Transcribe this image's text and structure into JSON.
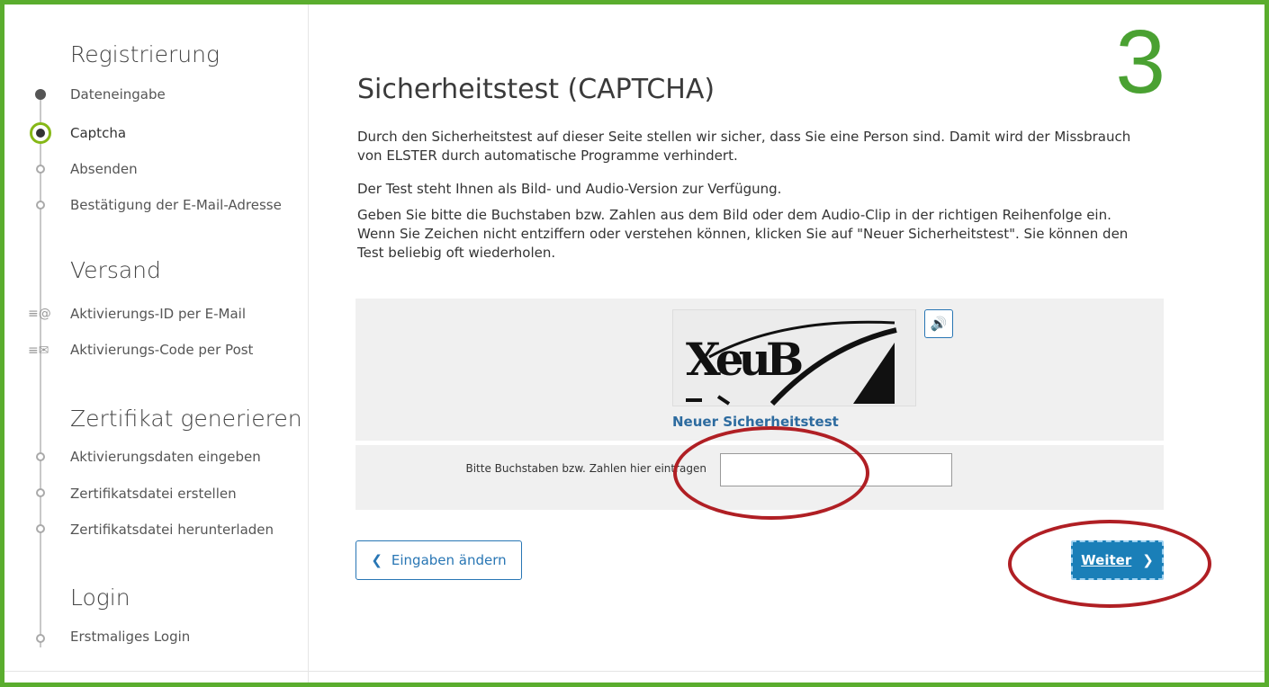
{
  "step_number": "3",
  "sidebar": {
    "sections": [
      {
        "title": "Registrierung",
        "items": [
          {
            "label": "Dateneingabe",
            "state": "done"
          },
          {
            "label": "Captcha",
            "state": "current"
          },
          {
            "label": "Absenden",
            "state": "pending"
          },
          {
            "label": "Bestätigung der E-Mail-Adresse",
            "state": "pending"
          }
        ]
      },
      {
        "title": "Versand",
        "items": [
          {
            "label": "Aktivierungs-ID per E-Mail",
            "icon": "email-at-icon"
          },
          {
            "label": "Aktivierungs-Code per Post",
            "icon": "letter-icon"
          }
        ]
      },
      {
        "title": "Zertifikat generieren",
        "items": [
          {
            "label": "Aktivierungsdaten eingeben",
            "state": "pending"
          },
          {
            "label": "Zertifikatsdatei erstellen",
            "state": "pending"
          },
          {
            "label": "Zertifikatsdatei herunterladen",
            "state": "pending"
          }
        ]
      },
      {
        "title": "Login",
        "items": [
          {
            "label": "Erstmaliges Login",
            "state": "pending"
          }
        ]
      }
    ]
  },
  "main": {
    "title": "Sicherheitstest (CAPTCHA)",
    "paragraphs": [
      "Durch den Sicherheitstest auf dieser Seite stellen wir sicher, dass Sie eine Person sind. Damit wird der Missbrauch von ELSTER durch automatische Programme verhindert.",
      "Der Test steht Ihnen als Bild- und Audio-Version zur Verfügung.",
      "Geben Sie bitte die Buchstaben bzw. Zahlen aus dem Bild oder dem Audio-Clip in der richtigen Reihenfolge ein. Wenn Sie Zeichen nicht entziffern oder verstehen können, klicken Sie auf \"Neuer Sicherheitstest\". Sie können den Test beliebig oft wiederholen."
    ],
    "captcha": {
      "image_text": "XeuB",
      "audio_icon": "speaker-icon",
      "new_test_link": "Neuer Sicherheitstest"
    },
    "input": {
      "label": "Bitte Buchstaben bzw. Zahlen hier eintragen",
      "value": ""
    },
    "buttons": {
      "back": "Eingaben ändern",
      "next": "Weiter"
    }
  },
  "colors": {
    "frame": "#5aad2e",
    "current_step": "#86b817",
    "primary_blue": "#1a7fb8",
    "annotation_red": "#b01f24"
  }
}
